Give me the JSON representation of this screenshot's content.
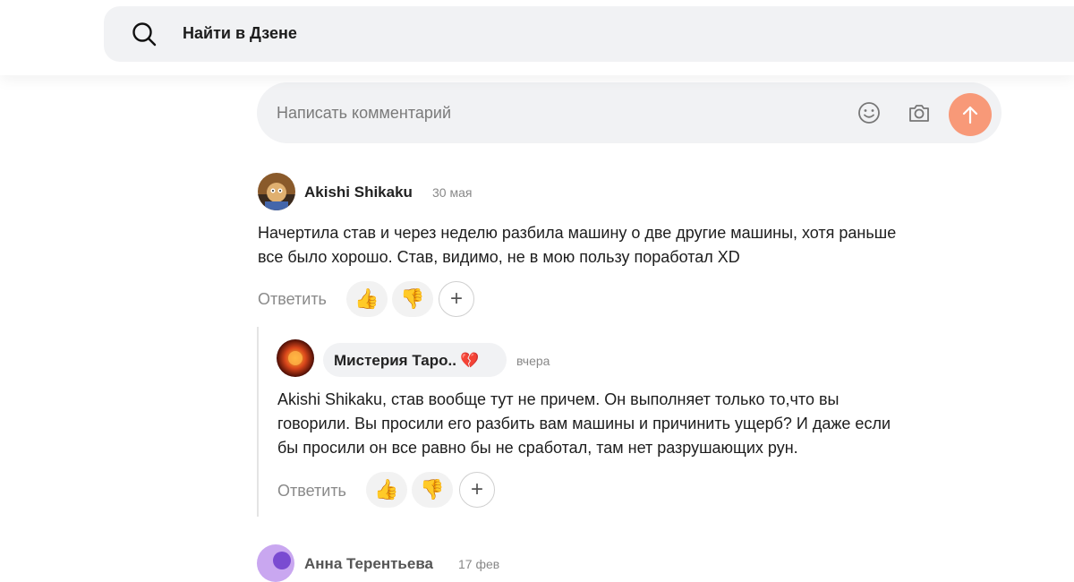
{
  "header": {
    "search_label": "Найти в Дзене"
  },
  "comment_form": {
    "placeholder": "Написать комментарий",
    "icons": [
      "emoji-icon",
      "camera-icon",
      "arrow-up-icon"
    ],
    "send_color": "#f89978"
  },
  "comments": [
    {
      "author": "Akishi Shikaku",
      "date": "30 мая",
      "text_line1": "Начертила став и через неделю разбила машину о две другие машины, хотя раньше",
      "text_line2": "все было хорошо. Став, видимо, не в мою пользу поработал XD",
      "reply_label": "Ответить",
      "like_emoji": "👍",
      "dislike_emoji": "👎",
      "plus_label": "+"
    },
    {
      "author": "Мистерия Таро..",
      "author_emoji": "💔",
      "date": "вчера",
      "text_line1": "Akishi Shikaku, став вообще тут не причем. Он выполняет только то,что вы",
      "text_line2": "говорили. Вы просили его разбить вам машины и причинить ущерб? И даже если",
      "text_line3": "бы просили он все равно бы не сработал, там нет разрушающих рун.",
      "reply_label": "Ответить",
      "like_emoji": "👍",
      "dislike_emoji": "👎",
      "plus_label": "+"
    },
    {
      "author": "Анна Терентьева",
      "date": "17 фев"
    }
  ]
}
